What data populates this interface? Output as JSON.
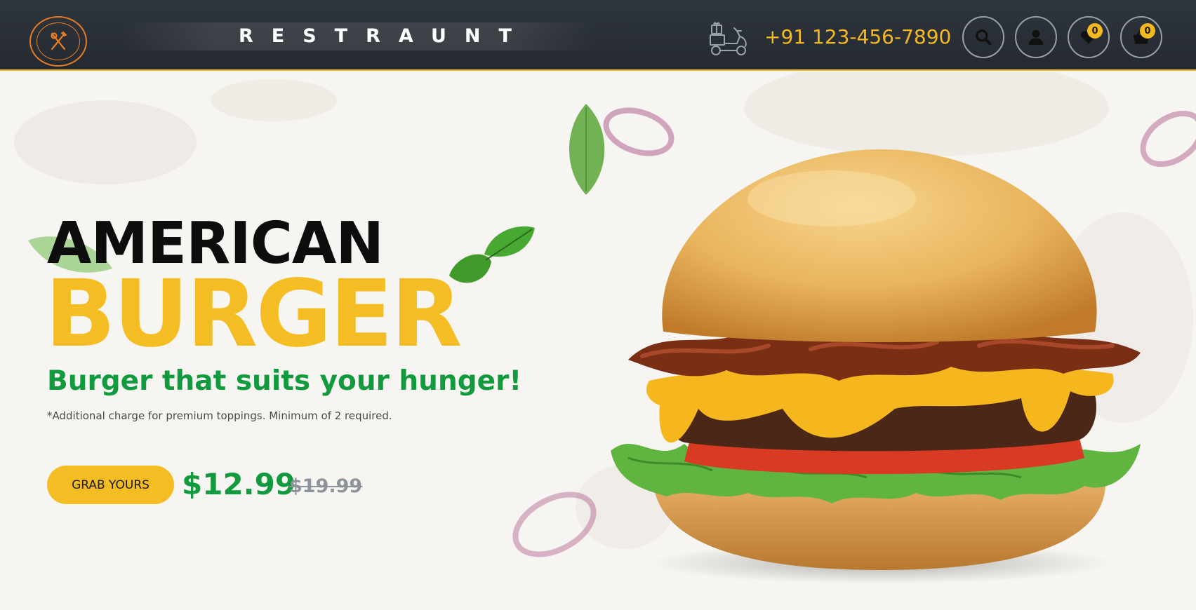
{
  "header": {
    "logo_name": "logo",
    "brand": "RESTRAUNT",
    "phone": "+91 123-456-7890",
    "buttons": {
      "search_icon": "search-icon",
      "account_icon": "user-icon",
      "wishlist_icon": "heart-icon",
      "cart_icon": "basket-icon"
    },
    "wishlist_count": "0",
    "cart_count": "0"
  },
  "hero": {
    "title_line1": "AMERICAN",
    "title_line2": "BURGER",
    "tagline": "Burger that suits your hunger!",
    "note": "*Additional charge for premium toppings. Minimum of 2 required.",
    "cta_label": "GRAB YOURS",
    "price": "$12.99",
    "old_price": "$19.99"
  },
  "colors": {
    "header_bg": "#2a2f36",
    "accent_yellow": "#f5bd24",
    "accent_green": "#129a3e",
    "logo_orange": "#e77c25",
    "hero_bg": "#f7f5f1"
  }
}
